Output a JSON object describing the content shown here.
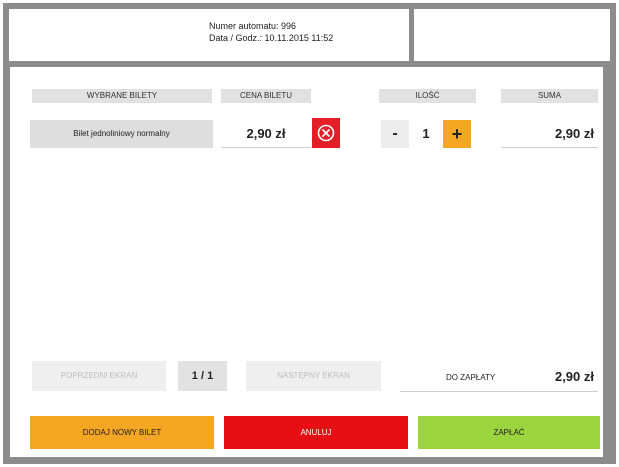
{
  "header": {
    "machine_number": "Numer automatu: 996",
    "date_time": "Data / Godz.: 10.11.2015 11:52"
  },
  "columns": {
    "selected": "WYBRANE BILETY",
    "price": "CENA BILETU",
    "quantity": "ILOŚĆ",
    "sum": "SUMA"
  },
  "ticket": {
    "name": "Bilet jednoliniowy normalny",
    "price": "2,90 zł",
    "quantity": "1",
    "sum": "2,90 zł",
    "minus": "-",
    "plus": "+"
  },
  "pagination": {
    "prev": "POPRZEDNI EKRAN",
    "page": "1 / 1",
    "next": "NASTĘPNY EKRAN"
  },
  "total": {
    "label": "DO ZAPŁATY",
    "value": "2,90 zł"
  },
  "actions": {
    "add": "DODAJ NOWY BILET",
    "cancel": "ANULUJ",
    "pay": "ZAPŁAĆ"
  },
  "colors": {
    "add": "#f5a623",
    "cancel": "#e80f14",
    "pay": "#9bd43c",
    "remove": "#e41e26"
  }
}
